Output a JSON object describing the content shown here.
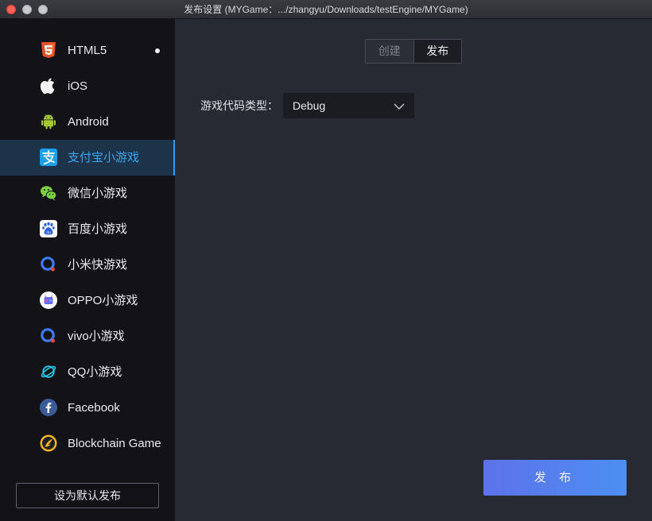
{
  "window": {
    "title": "发布设置 (MYGame：.../zhangyu/Downloads/testEngine/MYGame)"
  },
  "sidebar": {
    "items": [
      {
        "label": "HTML5",
        "icon": "html5-icon",
        "active": false,
        "dot": true
      },
      {
        "label": "iOS",
        "icon": "apple-icon",
        "active": false
      },
      {
        "label": "Android",
        "icon": "android-icon",
        "active": false
      },
      {
        "label": "支付宝小游戏",
        "icon": "alipay-icon",
        "active": true
      },
      {
        "label": "微信小游戏",
        "icon": "wechat-icon",
        "active": false
      },
      {
        "label": "百度小游戏",
        "icon": "baidu-icon",
        "active": false
      },
      {
        "label": "小米快游戏",
        "icon": "xiaomi-quickgame-icon",
        "active": false
      },
      {
        "label": "OPPO小游戏",
        "icon": "oppo-icon",
        "active": false
      },
      {
        "label": "vivo小游戏",
        "icon": "vivo-icon",
        "active": false
      },
      {
        "label": "QQ小游戏",
        "icon": "qq-icon",
        "active": false
      },
      {
        "label": "Facebook",
        "icon": "facebook-icon",
        "active": false
      },
      {
        "label": "Blockchain Game",
        "icon": "blockchain-icon",
        "active": false
      }
    ],
    "default_button": "设为默认发布"
  },
  "main": {
    "tabs": [
      {
        "label": "创建",
        "active": false
      },
      {
        "label": "发布",
        "active": true
      }
    ],
    "code_type": {
      "label": "游戏代码类型：",
      "value": "Debug"
    },
    "publish_button": "发 布"
  },
  "colors": {
    "accent": "#2f9bea",
    "sidebar_bg": "#131317",
    "main_bg": "#272a33",
    "publish_gradient_start": "#5d72ea",
    "publish_gradient_end": "#4c8ff2"
  }
}
